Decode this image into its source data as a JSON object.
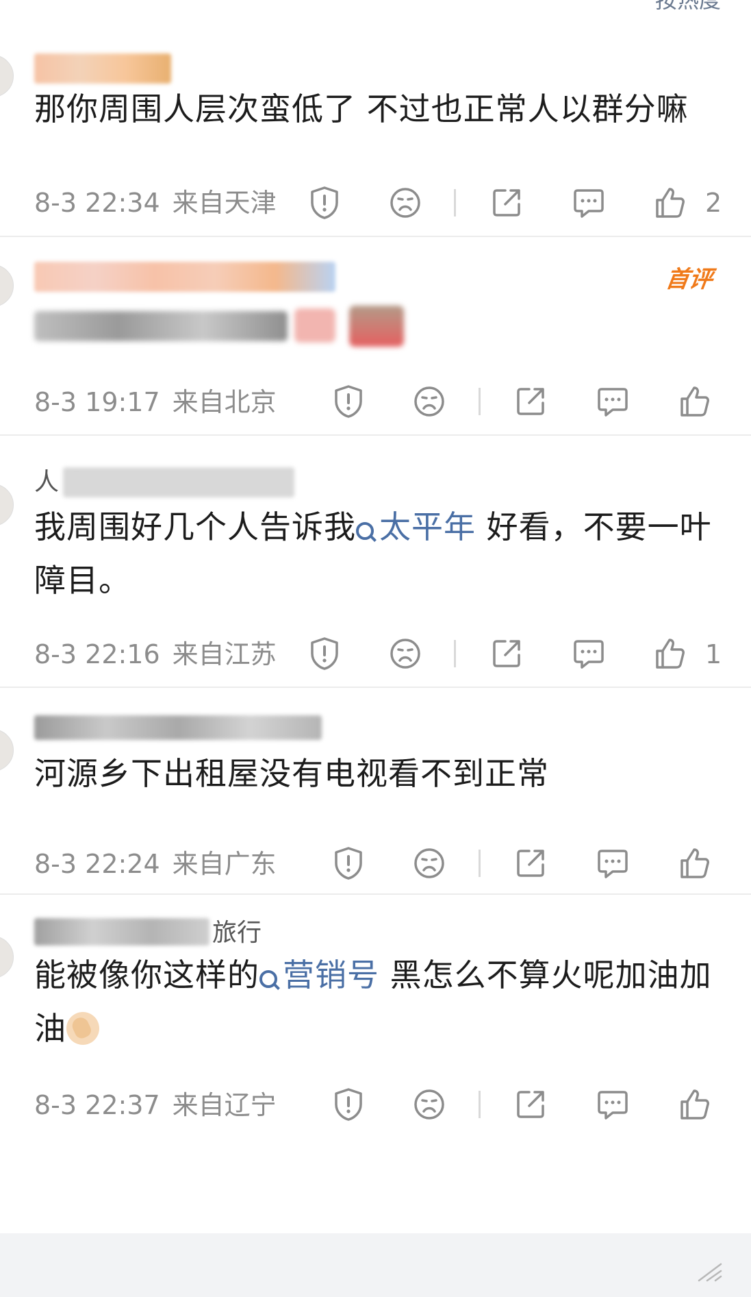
{
  "sort_label": "按热度",
  "comments": [
    {
      "username": "",
      "text": "那你周围人层次蛮低了 不过也正常人以群分嘛",
      "time": "8-3 22:34",
      "location": "来自天津",
      "likes": "2",
      "first_badge": ""
    },
    {
      "username": "",
      "text": "",
      "time": "8-3 19:17",
      "location": "来自北京",
      "likes": "",
      "first_badge": "首评"
    },
    {
      "username": "人 flower",
      "text_before": "我周围好几个人告诉我",
      "tag": "太平年",
      "text_after": " 好看，不要一叶障目。",
      "time": "8-3 22:16",
      "location": "来自江苏",
      "likes": "1",
      "first_badge": ""
    },
    {
      "username": "",
      "text": "河源乡下出租屋没有电视看不到正常",
      "time": "8-3 22:24",
      "location": "来自广东",
      "likes": "",
      "first_badge": ""
    },
    {
      "username": "旅行",
      "text_before": "能被像你这样的",
      "tag": "营销号",
      "text_after": " 黑怎么不算火呢加油加油",
      "time": "8-3 22:37",
      "location": "来自辽宁",
      "likes": "",
      "first_badge": ""
    }
  ],
  "icons": {
    "report": "report-icon",
    "dislike": "dislike-face-icon",
    "share": "share-icon",
    "reply": "reply-icon",
    "like": "like-thumb-icon"
  },
  "colors": {
    "tag": "#4a6fa5",
    "first_badge": "#f07a1a",
    "meta": "#8c8c8c"
  }
}
